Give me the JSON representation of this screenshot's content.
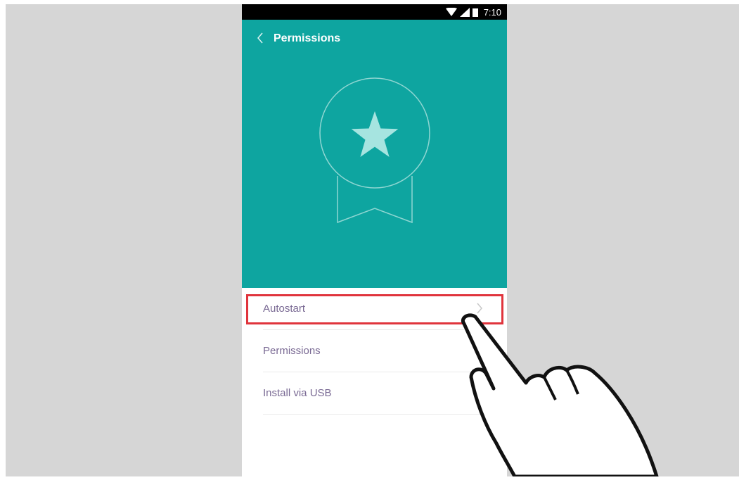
{
  "status_bar": {
    "time": "7:10",
    "icons": [
      "wifi-icon",
      "cell-signal-icon",
      "battery-icon"
    ]
  },
  "header": {
    "title": "Permissions",
    "back_icon": "chevron-left-icon",
    "illustration": "award-badge-star-icon"
  },
  "list": {
    "items": [
      {
        "label": "Autostart",
        "highlighted": true
      },
      {
        "label": "Permissions",
        "highlighted": false
      },
      {
        "label": "Install via USB",
        "highlighted": false
      }
    ]
  },
  "annotation": {
    "highlight_color": "#e0343c",
    "pointer": "hand-pointer-icon"
  },
  "colors": {
    "header_bg": "#0ea5a0",
    "backdrop": "#d6d6d6",
    "item_text": "#7a6a94",
    "star": "#a6e4e0"
  }
}
